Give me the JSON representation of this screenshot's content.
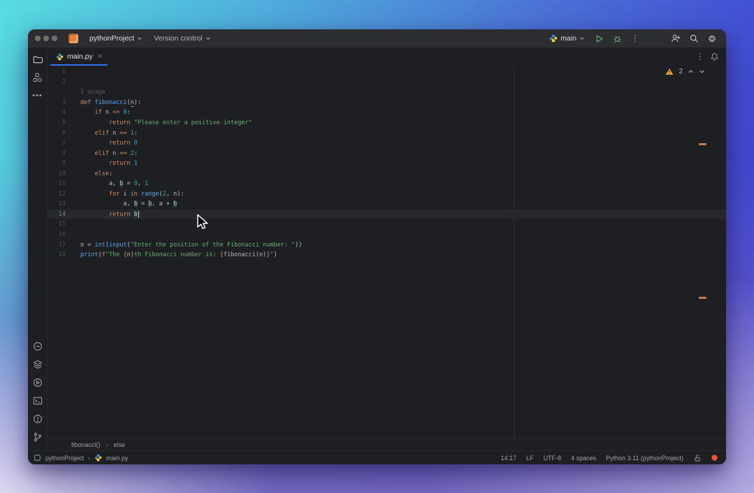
{
  "titlebar": {
    "project_name": "pythonProject",
    "vcs_label": "Version control",
    "run_config_name": "main"
  },
  "tabbar": {
    "active_tab": "main.py",
    "close_glyph": "×",
    "more_glyph": "⋮"
  },
  "editor": {
    "inspection_warning_count": "2",
    "inlay_hint": "1 usage",
    "lines": [
      {
        "n": 1,
        "seg": []
      },
      {
        "n": 2,
        "seg": []
      },
      {
        "inlay": "1 usage"
      },
      {
        "n": 3,
        "seg": [
          {
            "t": "def ",
            "c": "k"
          },
          {
            "t": "fibonacci",
            "c": "f"
          },
          {
            "t": "(",
            "c": "d"
          },
          {
            "t": "n",
            "c": "p"
          },
          {
            "t": "):",
            "c": "d"
          }
        ]
      },
      {
        "n": 4,
        "seg": [
          {
            "t": "    ",
            "c": "d"
          },
          {
            "t": "if",
            "c": "k"
          },
          {
            "t": " n ",
            "c": "d"
          },
          {
            "t": "<=",
            "c": "k"
          },
          {
            "t": " ",
            "c": "d"
          },
          {
            "t": "0",
            "c": "num"
          },
          {
            "t": ":",
            "c": "d"
          }
        ]
      },
      {
        "n": 5,
        "seg": [
          {
            "t": "        ",
            "c": "d"
          },
          {
            "t": "return",
            "c": "k"
          },
          {
            "t": " ",
            "c": "d"
          },
          {
            "t": "\"Please enter a positive integer\"",
            "c": "s"
          }
        ]
      },
      {
        "n": 6,
        "seg": [
          {
            "t": "    ",
            "c": "d"
          },
          {
            "t": "elif",
            "c": "k"
          },
          {
            "t": " n ",
            "c": "d"
          },
          {
            "t": "==",
            "c": "k"
          },
          {
            "t": " ",
            "c": "d"
          },
          {
            "t": "1",
            "c": "num"
          },
          {
            "t": ":",
            "c": "d"
          }
        ]
      },
      {
        "n": 7,
        "seg": [
          {
            "t": "        ",
            "c": "d"
          },
          {
            "t": "return",
            "c": "k"
          },
          {
            "t": " ",
            "c": "d"
          },
          {
            "t": "0",
            "c": "num"
          }
        ]
      },
      {
        "n": 8,
        "seg": [
          {
            "t": "    ",
            "c": "d"
          },
          {
            "t": "elif",
            "c": "k"
          },
          {
            "t": " n ",
            "c": "d"
          },
          {
            "t": "==",
            "c": "k"
          },
          {
            "t": " ",
            "c": "d"
          },
          {
            "t": "2",
            "c": "num"
          },
          {
            "t": ":",
            "c": "d"
          }
        ]
      },
      {
        "n": 9,
        "seg": [
          {
            "t": "        ",
            "c": "d"
          },
          {
            "t": "return",
            "c": "k"
          },
          {
            "t": " ",
            "c": "d"
          },
          {
            "t": "1",
            "c": "num"
          }
        ]
      },
      {
        "n": 10,
        "seg": [
          {
            "t": "    ",
            "c": "d"
          },
          {
            "t": "else",
            "c": "k"
          },
          {
            "t": ":",
            "c": "d"
          }
        ]
      },
      {
        "n": 11,
        "seg": [
          {
            "t": "        a, ",
            "c": "d"
          },
          {
            "t": "b",
            "c": "hl"
          },
          {
            "t": " = ",
            "c": "d"
          },
          {
            "t": "0",
            "c": "num"
          },
          {
            "t": ", ",
            "c": "d"
          },
          {
            "t": "1",
            "c": "num"
          }
        ]
      },
      {
        "n": 12,
        "seg": [
          {
            "t": "        ",
            "c": "d"
          },
          {
            "t": "for",
            "c": "k"
          },
          {
            "t": " i ",
            "c": "d"
          },
          {
            "t": "in",
            "c": "k"
          },
          {
            "t": " ",
            "c": "d"
          },
          {
            "t": "range",
            "c": "f"
          },
          {
            "t": "(",
            "c": "d"
          },
          {
            "t": "2",
            "c": "num"
          },
          {
            "t": ", n):",
            "c": "d"
          }
        ]
      },
      {
        "n": 13,
        "seg": [
          {
            "t": "            a, ",
            "c": "d"
          },
          {
            "t": "b",
            "c": "hl"
          },
          {
            "t": " = ",
            "c": "d"
          },
          {
            "t": "b",
            "c": "hl"
          },
          {
            "t": ", a + ",
            "c": "d"
          },
          {
            "t": "b",
            "c": "hl"
          }
        ]
      },
      {
        "n": 14,
        "current": true,
        "caret": true,
        "seg": [
          {
            "t": "        ",
            "c": "d"
          },
          {
            "t": "return",
            "c": "k"
          },
          {
            "t": " ",
            "c": "d"
          },
          {
            "t": "b",
            "c": "hl"
          }
        ]
      },
      {
        "n": 15,
        "seg": []
      },
      {
        "n": 16,
        "seg": []
      },
      {
        "n": 17,
        "seg": [
          {
            "t": "n = ",
            "c": "d"
          },
          {
            "t": "int",
            "c": "f"
          },
          {
            "t": "(",
            "c": "d"
          },
          {
            "t": "input",
            "c": "f"
          },
          {
            "t": "(",
            "c": "d"
          },
          {
            "t": "\"Enter the position of the Fibonacci number: \"",
            "c": "s"
          },
          {
            "t": "))",
            "c": "d"
          }
        ]
      },
      {
        "n": 18,
        "seg": [
          {
            "t": "print",
            "c": "f"
          },
          {
            "t": "(",
            "c": "d"
          },
          {
            "t": "f",
            "c": "k"
          },
          {
            "t": "\"The ",
            "c": "s"
          },
          {
            "t": "{",
            "c": "br"
          },
          {
            "t": "n",
            "c": "d"
          },
          {
            "t": "}",
            "c": "br"
          },
          {
            "t": "th Fibonacci number is: ",
            "c": "s"
          },
          {
            "t": "{",
            "c": "br"
          },
          {
            "t": "fibonacci(n)",
            "c": "d"
          },
          {
            "t": "}",
            "c": "br"
          },
          {
            "t": "\"",
            "c": "s"
          },
          {
            "t": ")",
            "c": "d"
          }
        ]
      }
    ]
  },
  "breadcrumbs": {
    "items": [
      "fibonacci()",
      "else"
    ],
    "separator": "›"
  },
  "statusbar": {
    "project": "pythonProject",
    "separator": "›",
    "file": "main.py",
    "caret_position": "14:17",
    "line_ending": "LF",
    "encoding": "UTF-8",
    "indent": "4 spaces",
    "interpreter": "Python 3.11 (pythonProject)"
  },
  "colors": {
    "accent_blue": "#3574F0",
    "keyword": "#CF8E6D",
    "string": "#6AAB73",
    "number": "#2AACB8",
    "function": "#56A8F5",
    "warning": "#E8A33D",
    "run_green": "#6CAE75",
    "error_badge": "#E3573B",
    "editor_bg": "#1e1f22",
    "titlebar_bg": "#2b2d30"
  },
  "icons": [
    "folder-icon",
    "structure-icon",
    "more-icon",
    "python-console-icon",
    "packages-icon",
    "services-icon",
    "terminal-icon",
    "problems-icon",
    "git-branch-icon",
    "python-logo-icon",
    "play-icon",
    "debug-icon",
    "kebab-icon",
    "add-user-icon",
    "search-icon",
    "gear-icon",
    "bell-icon",
    "warning-icon",
    "chevron-down-icon",
    "chevron-up-icon",
    "lock-icon",
    "close-icon",
    "mouse-cursor"
  ]
}
